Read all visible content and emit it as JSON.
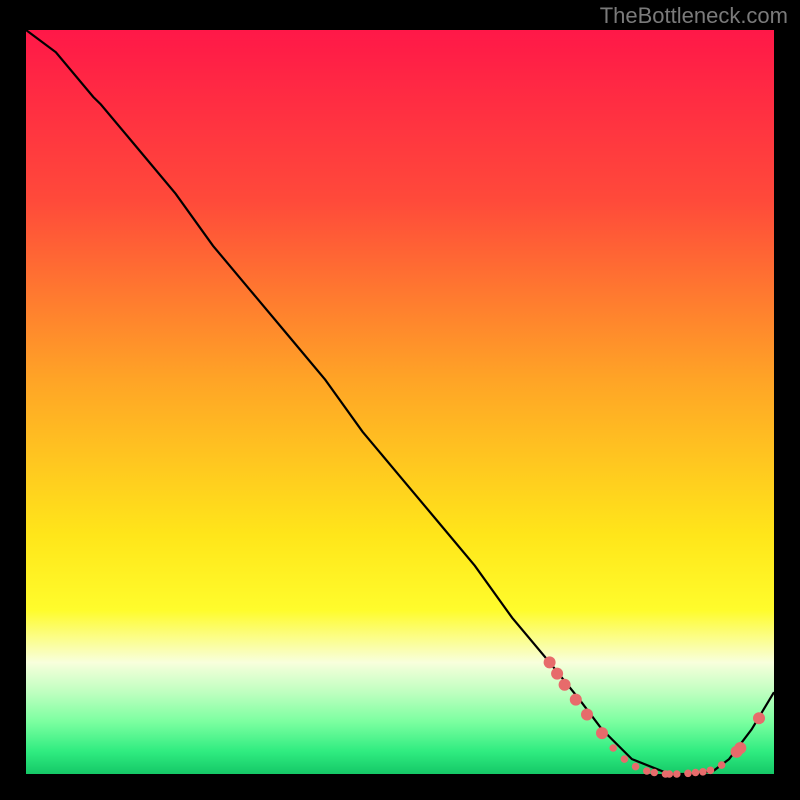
{
  "attribution": "TheBottleneck.com",
  "chart_data": {
    "type": "line",
    "title": "",
    "xlabel": "",
    "ylabel": "",
    "xlim": [
      0,
      100
    ],
    "ylim": [
      0,
      100
    ],
    "grid": false,
    "background_gradient": {
      "stops": [
        {
          "offset": 0.0,
          "color": "#ff1848"
        },
        {
          "offset": 0.23,
          "color": "#ff4a3a"
        },
        {
          "offset": 0.47,
          "color": "#ffa426"
        },
        {
          "offset": 0.68,
          "color": "#ffe61a"
        },
        {
          "offset": 0.78,
          "color": "#fffc2c"
        },
        {
          "offset": 0.85,
          "color": "#f8ffdc"
        },
        {
          "offset": 0.89,
          "color": "#bfffc0"
        },
        {
          "offset": 0.93,
          "color": "#7bffa0"
        },
        {
          "offset": 0.97,
          "color": "#2fec80"
        },
        {
          "offset": 1.0,
          "color": "#15c867"
        }
      ]
    },
    "series": [
      {
        "name": "bottleneck-curve",
        "color": "#000000",
        "x": [
          0,
          4,
          9,
          10,
          15,
          20,
          25,
          30,
          35,
          40,
          45,
          50,
          55,
          60,
          65,
          70,
          74,
          77,
          81,
          86,
          90,
          92,
          94,
          97,
          100
        ],
        "y": [
          100,
          97,
          91,
          90,
          84,
          78,
          71,
          65,
          59,
          53,
          46,
          40,
          34,
          28,
          21,
          15,
          10,
          6,
          2,
          0,
          0,
          0.5,
          2,
          6,
          11
        ]
      }
    ],
    "markers": {
      "name": "highlight-dots",
      "color": "#e76b6b",
      "radius_large": 6,
      "radius_small": 3.8,
      "points": [
        {
          "x": 70,
          "y": 15,
          "r": "large"
        },
        {
          "x": 71,
          "y": 13.5,
          "r": "large"
        },
        {
          "x": 72,
          "y": 12,
          "r": "large"
        },
        {
          "x": 73.5,
          "y": 10,
          "r": "large"
        },
        {
          "x": 75,
          "y": 8,
          "r": "large"
        },
        {
          "x": 77,
          "y": 5.5,
          "r": "large"
        },
        {
          "x": 78.5,
          "y": 3.5,
          "r": "small"
        },
        {
          "x": 80,
          "y": 2,
          "r": "small"
        },
        {
          "x": 81.5,
          "y": 1,
          "r": "small"
        },
        {
          "x": 83,
          "y": 0.4,
          "r": "small"
        },
        {
          "x": 84,
          "y": 0.2,
          "r": "small"
        },
        {
          "x": 85.5,
          "y": 0,
          "r": "small"
        },
        {
          "x": 86,
          "y": 0,
          "r": "small"
        },
        {
          "x": 87,
          "y": 0,
          "r": "small"
        },
        {
          "x": 88.5,
          "y": 0.1,
          "r": "small"
        },
        {
          "x": 89.5,
          "y": 0.2,
          "r": "small"
        },
        {
          "x": 90.5,
          "y": 0.3,
          "r": "small"
        },
        {
          "x": 91.5,
          "y": 0.5,
          "r": "small"
        },
        {
          "x": 93,
          "y": 1.2,
          "r": "small"
        },
        {
          "x": 95,
          "y": 3,
          "r": "large"
        },
        {
          "x": 95.5,
          "y": 3.5,
          "r": "large"
        },
        {
          "x": 98,
          "y": 7.5,
          "r": "large"
        }
      ]
    }
  }
}
